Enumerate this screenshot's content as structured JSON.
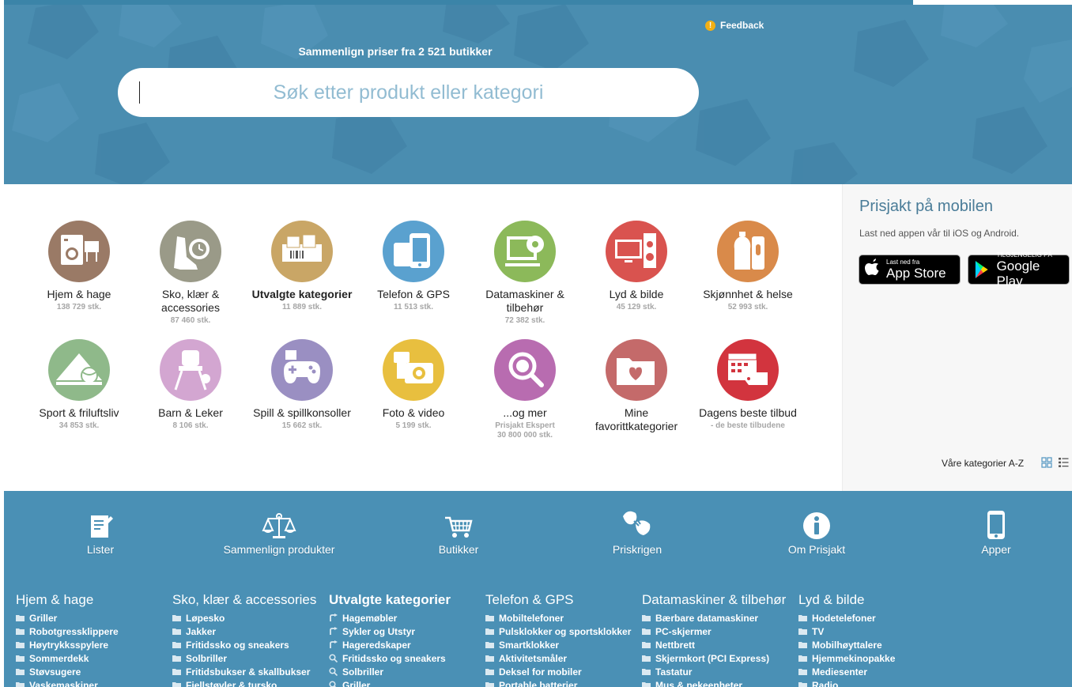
{
  "hero": {
    "feedback_label": "Feedback",
    "subtitle": "Sammenlign priser fra 2 521 butikker",
    "search_placeholder": "Søk etter produkt eller kategori"
  },
  "categories": [
    {
      "name": "Hjem & hage",
      "count": "138 729 stk.",
      "color": "#9a7a66",
      "icon": "home-appliance-icon",
      "bold": false
    },
    {
      "name": "Sko, klær & accessories",
      "count": "87 460 stk.",
      "color": "#9a9a88",
      "icon": "shoe-watch-icon",
      "bold": false
    },
    {
      "name": "Utvalgte kategorier",
      "count": "11 889 stk.",
      "color": "#c9a666",
      "icon": "featured-products-icon",
      "bold": true
    },
    {
      "name": "Telefon & GPS",
      "count": "11 513 stk.",
      "color": "#5aa1cf",
      "icon": "phone-icon",
      "bold": false
    },
    {
      "name": "Datamaskiner & tilbehør",
      "count": "72 382 stk.",
      "color": "#8cb95a",
      "icon": "computer-icon",
      "bold": false
    },
    {
      "name": "Lyd & bilde",
      "count": "45 129 stk.",
      "color": "#d9534f",
      "icon": "tv-speaker-icon",
      "bold": false
    },
    {
      "name": "Skjønnhet & helse",
      "count": "52 993 stk.",
      "color": "#d98a4a",
      "icon": "beauty-bottle-icon",
      "bold": false
    },
    {
      "name": "Sport & friluftsliv",
      "count": "34 853 stk.",
      "color": "#8fb98a",
      "icon": "tent-ball-icon",
      "bold": false
    },
    {
      "name": "Barn & Leker",
      "count": "8 106 stk.",
      "color": "#d3a6d1",
      "icon": "high-chair-icon",
      "bold": false
    },
    {
      "name": "Spill & spillkonsoller",
      "count": "15 662 stk.",
      "color": "#9a8fc2",
      "icon": "gamepad-icon",
      "bold": false
    },
    {
      "name": "Foto & video",
      "count": "5 199 stk.",
      "color": "#e8bf3f",
      "icon": "camera-icon",
      "bold": false
    },
    {
      "name": "...og mer",
      "count": "Prisjakt Ekspert",
      "count2": "30 800 000 stk.",
      "color": "#b86cb0",
      "icon": "magnifier-icon",
      "bold": false
    },
    {
      "name": "Mine favorittkategorier",
      "count": "",
      "color": "#c46a6a",
      "icon": "heart-folder-icon",
      "bold": false
    },
    {
      "name": "Dagens beste tilbud",
      "count": "- de beste tilbudene",
      "color": "#d2343e",
      "icon": "calendar-tag-icon",
      "bold": false
    }
  ],
  "side": {
    "title": "Prisjakt på mobilen",
    "text": "Last ned appen vår til iOS og Android.",
    "appstore_small": "Last ned fra",
    "appstore_big": "App Store",
    "gplay_small": "TILGJENGELIG PÅ",
    "gplay_big": "Google Play",
    "az_label": "Våre kategorier A-Z"
  },
  "footer_nav": [
    {
      "label": "Lister",
      "icon": "list-edit-icon"
    },
    {
      "label": "Sammenlign produkter",
      "icon": "scales-icon"
    },
    {
      "label": "Butikker",
      "icon": "shopping-cart-icon"
    },
    {
      "label": "Priskrigen",
      "icon": "price-war-icon"
    },
    {
      "label": "Om Prisjakt",
      "icon": "info-icon"
    },
    {
      "label": "Apper",
      "icon": "mobile-icon"
    }
  ],
  "footer_columns": [
    {
      "title": "Hjem & hage",
      "bold": false,
      "links": [
        {
          "label": "Griller",
          "type": "folder"
        },
        {
          "label": "Robotgressklippere",
          "type": "folder"
        },
        {
          "label": "Høytrykksspylere",
          "type": "folder"
        },
        {
          "label": "Sommerdekk",
          "type": "folder"
        },
        {
          "label": "Støvsugere",
          "type": "folder"
        },
        {
          "label": "Vaskemaskiner",
          "type": "folder"
        }
      ]
    },
    {
      "title": "Sko, klær & accessories",
      "bold": false,
      "links": [
        {
          "label": "Løpesko",
          "type": "folder"
        },
        {
          "label": "Jakker",
          "type": "folder"
        },
        {
          "label": "Fritidssko og sneakers",
          "type": "folder"
        },
        {
          "label": "Solbriller",
          "type": "folder"
        },
        {
          "label": "Fritidsbukser & skallbukser",
          "type": "folder"
        },
        {
          "label": "Fjellstøvler & tursko",
          "type": "folder"
        }
      ]
    },
    {
      "title": "Utvalgte kategorier",
      "bold": true,
      "links": [
        {
          "label": "Hagemøbler",
          "type": "arrow"
        },
        {
          "label": "Sykler og Utstyr",
          "type": "arrow"
        },
        {
          "label": "Hageredskaper",
          "type": "arrow"
        },
        {
          "label": "Fritidssko og sneakers",
          "type": "search"
        },
        {
          "label": "Solbriller",
          "type": "search"
        },
        {
          "label": "Griller",
          "type": "search"
        }
      ]
    },
    {
      "title": "Telefon & GPS",
      "bold": false,
      "links": [
        {
          "label": "Mobiltelefoner",
          "type": "folder"
        },
        {
          "label": "Pulsklokker og sportsklokker",
          "type": "folder"
        },
        {
          "label": "Smartklokker",
          "type": "folder"
        },
        {
          "label": "Aktivitetsmåler",
          "type": "folder"
        },
        {
          "label": "Deksel for mobiler",
          "type": "folder"
        },
        {
          "label": "Portable batterier",
          "type": "folder"
        }
      ]
    },
    {
      "title": "Datamaskiner & tilbehør",
      "bold": false,
      "links": [
        {
          "label": "Bærbare datamaskiner",
          "type": "folder"
        },
        {
          "label": "PC-skjermer",
          "type": "folder"
        },
        {
          "label": "Nettbrett",
          "type": "folder"
        },
        {
          "label": "Skjermkort (PCI Express)",
          "type": "folder"
        },
        {
          "label": "Tastatur",
          "type": "folder"
        },
        {
          "label": "Mus & pekeenheter",
          "type": "folder"
        }
      ]
    },
    {
      "title": "Lyd & bilde",
      "bold": false,
      "links": [
        {
          "label": "Hodetelefoner",
          "type": "folder"
        },
        {
          "label": "TV",
          "type": "folder"
        },
        {
          "label": "Mobilhøyttalere",
          "type": "folder"
        },
        {
          "label": "Hjemmekinopakke",
          "type": "folder"
        },
        {
          "label": "Mediesenter",
          "type": "folder"
        },
        {
          "label": "Radio",
          "type": "folder"
        }
      ]
    }
  ]
}
